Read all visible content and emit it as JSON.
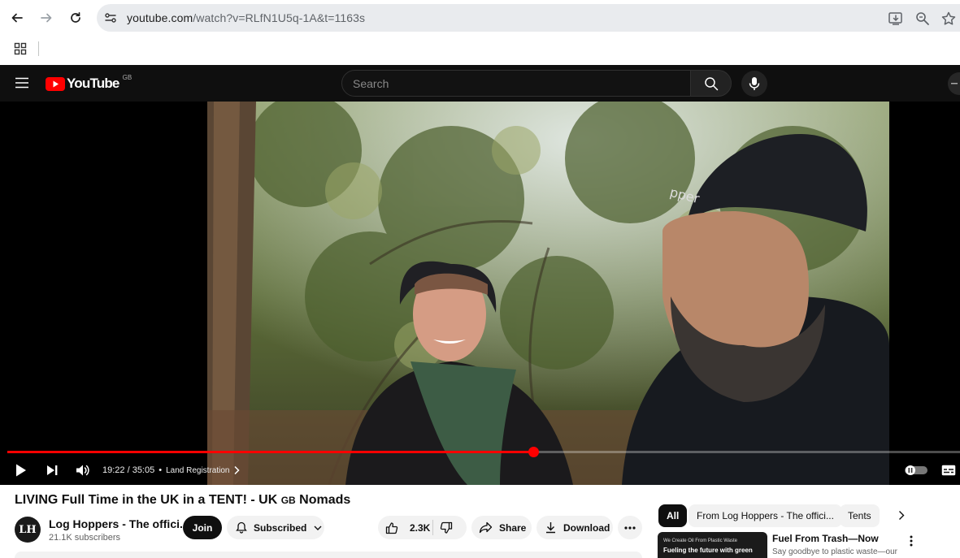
{
  "browser": {
    "url_host": "youtube.com",
    "url_path": "/watch?v=RLfN1U5q-1A&t=1163s"
  },
  "youtube": {
    "logo_text": "YouTube",
    "region": "GB",
    "search_placeholder": "Search"
  },
  "player": {
    "time": "19:22 / 35:05",
    "separator": "•",
    "chapter": "Land Registration",
    "progress_fraction": 0.552
  },
  "video": {
    "title_main": "LIVING Full Time in the UK in a TENT! - UK ",
    "title_flag": "GB",
    "title_tail": " Nomads",
    "channel_initials": "LH",
    "channel_name": "Log Hoppers - The offici...",
    "subscribers": "21.1K subscribers",
    "join_label": "Join",
    "subscribed_label": "Subscribed",
    "likes": "2.3K",
    "share_label": "Share",
    "download_label": "Download"
  },
  "sidebar": {
    "chips": [
      "All",
      "From Log Hoppers - The offici...",
      "Tents"
    ],
    "rec": {
      "thumb_line1": "We Create Oil From Plastic Waste",
      "thumb_line2": "Fueling the future with green",
      "title": "Fuel From Trash—Now",
      "desc": "Say goodbye to plastic waste—our"
    }
  },
  "colors": {
    "yt_red": "#ff0000",
    "header_bg": "#0f0f0f",
    "progress_played": "#ff0000"
  }
}
